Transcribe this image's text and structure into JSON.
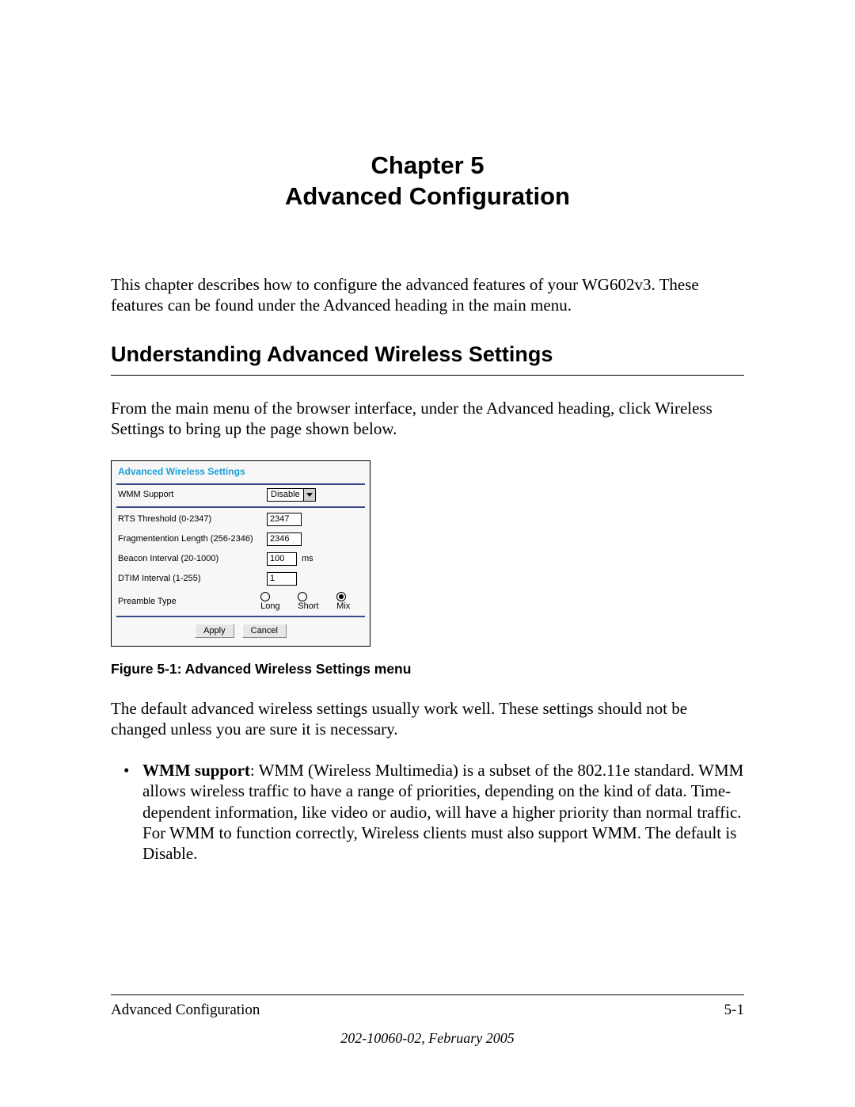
{
  "chapter": {
    "line1": "Chapter 5",
    "line2": "Advanced Configuration"
  },
  "intro": "This chapter describes how to configure the advanced features of your WG602v3. These features can be found under the Advanced heading in the main menu.",
  "section_heading": "Understanding Advanced Wireless Settings",
  "section_intro": "From the main menu of the browser interface, under the Advanced heading, click Wireless Settings to bring up the page shown below.",
  "panel": {
    "title": "Advanced Wireless Settings",
    "wmm": {
      "label": "WMM Support",
      "value": "Disable"
    },
    "rts": {
      "label": "RTS Threshold (0-2347)",
      "value": "2347"
    },
    "frag": {
      "label": "Fragmentention Length (256-2346)",
      "value": "2346"
    },
    "beacon": {
      "label": "Beacon Interval (20-1000)",
      "value": "100",
      "unit": "ms"
    },
    "dtim": {
      "label": "DTIM Interval (1-255)",
      "value": "1"
    },
    "preamble": {
      "label": "Preamble Type",
      "options": {
        "long": "Long",
        "short": "Short",
        "mix": "Mix"
      },
      "selected": "mix"
    },
    "buttons": {
      "apply": "Apply",
      "cancel": "Cancel"
    }
  },
  "figure_caption": "Figure 5-1:  Advanced Wireless Settings menu",
  "after_figure": "The default advanced wireless settings usually work well. These settings should not be changed unless you are sure it is necessary.",
  "bullet": {
    "lead": "WMM support",
    "text": ": WMM (Wireless Multimedia) is a subset of the 802.11e standard. WMM allows wireless traffic to have a range of priorities, depending on the kind of data. Time-dependent information, like video or audio, will have a higher priority than normal traffic. For WMM to function correctly, Wireless clients must also support WMM. The default is Disable."
  },
  "footer": {
    "left": "Advanced Configuration",
    "right": "5-1",
    "meta": "202-10060-02, February 2005"
  }
}
